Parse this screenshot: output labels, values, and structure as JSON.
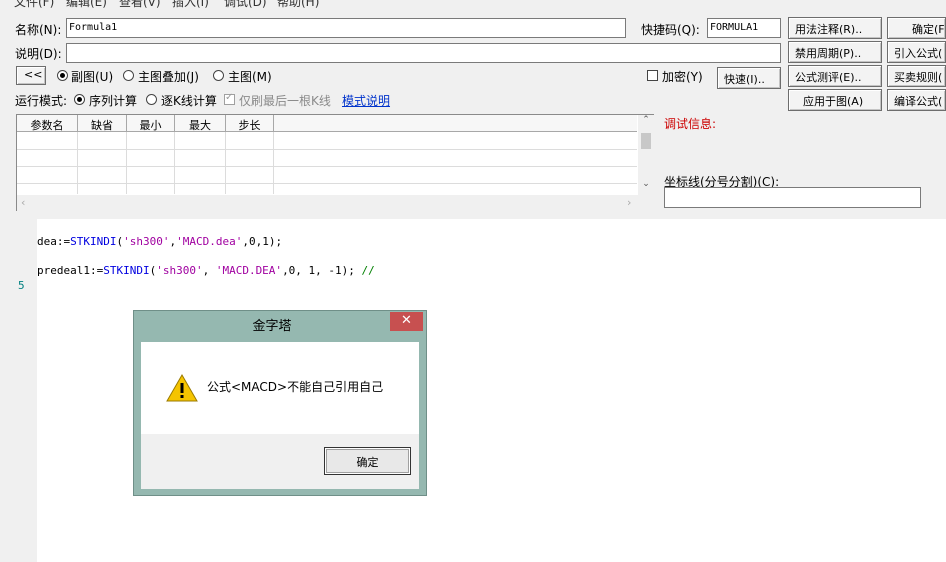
{
  "menu": [
    "文件(F)",
    "编辑(E)",
    "查看(V)",
    "插入(I)",
    "调试(D)",
    "帮助(H)"
  ],
  "form": {
    "name_label": "名称(N):",
    "name_value": "Formula1",
    "shortcut_label": "快捷码(Q):",
    "shortcut_value": "FORMULA1",
    "desc_label": "说明(D):",
    "desc_value": ""
  },
  "buttons": {
    "usage_note": "用法注释(R)..",
    "confirm": "确定(F",
    "disabled_period": "禁用周期(P)..",
    "import_formula": "引入公式(",
    "formula_test": "公式测评(E)..",
    "trade_rule": "买卖规则(",
    "apply_chart": "应用于图(A)",
    "compile": "编译公式(",
    "collapse": "<<",
    "quick": "快速(I).."
  },
  "chart_options": {
    "sub_chart": "副图(U)",
    "main_overlay": "主图叠加(J)",
    "main_chart": "主图(M)",
    "encrypt": "加密(Y)"
  },
  "run_mode": {
    "label": "运行模式:",
    "sequential": "序列计算",
    "per_kline": "逐K线计算",
    "refresh_last": "仅刷最后一根K线",
    "mode_help": "模式说明"
  },
  "params_table": {
    "headers": [
      "参数名",
      "缺省",
      "最小",
      "最大",
      "步长"
    ]
  },
  "debug": {
    "label": "调试信息:",
    "coord_label": "坐标线(分号分割)(C):",
    "coord_value": ""
  },
  "editor": {
    "line_number": "5"
  },
  "dialog": {
    "title": "金字塔",
    "close": "✕",
    "message": "公式<MACD>不能自己引用自己",
    "ok": "确定"
  }
}
